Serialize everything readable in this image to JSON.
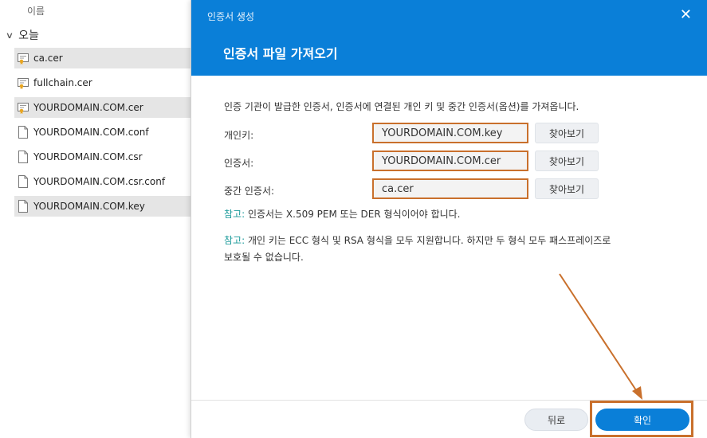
{
  "explorer": {
    "column_header": "이름",
    "group_label": "오늘",
    "files": [
      {
        "name": "ca.cer",
        "icon": "certificate-icon",
        "selected": true
      },
      {
        "name": "fullchain.cer",
        "icon": "certificate-icon",
        "selected": false
      },
      {
        "name": "YOURDOMAIN.COM.cer",
        "icon": "certificate-icon",
        "selected": true
      },
      {
        "name": "YOURDOMAIN.COM.conf",
        "icon": "file-icon",
        "selected": false
      },
      {
        "name": "YOURDOMAIN.COM.csr",
        "icon": "file-icon",
        "selected": false
      },
      {
        "name": "YOURDOMAIN.COM.csr.conf",
        "icon": "file-icon",
        "selected": false
      },
      {
        "name": "YOURDOMAIN.COM.key",
        "icon": "file-icon",
        "selected": true
      }
    ]
  },
  "dialog": {
    "title": "인증서 생성",
    "close_glyph": "✕",
    "heading": "인증서 파일 가져오기",
    "intro": "인증 기관이 발급한 인증서, 인증서에 연결된 개인 키 및 중간 인증서(옵션)를 가져옵니다.",
    "fields": [
      {
        "label": "개인키:",
        "value": "YOURDOMAIN.COM.key",
        "button": "찾아보기"
      },
      {
        "label": "인증서:",
        "value": "YOURDOMAIN.COM.cer",
        "button": "찾아보기"
      },
      {
        "label": "중간 인증서:",
        "value": "ca.cer",
        "button": "찾아보기"
      }
    ],
    "notes": [
      {
        "tag": "참고:",
        "text": " 인증서는 X.509 PEM 또는 DER 형식이어야 합니다."
      },
      {
        "tag": "참고:",
        "text": " 개인 키는 ECC 형식 및 RSA 형식을 모두 지원합니다. 하지만 두 형식 모두 패스프레이즈로",
        "text2": "보호될 수 없습니다."
      }
    ],
    "back_label": "뒤로",
    "ok_label": "확인"
  },
  "colors": {
    "header_blue": "#0a7fd8",
    "highlight_orange": "#c9702c",
    "note_teal": "#1a9a9a"
  }
}
